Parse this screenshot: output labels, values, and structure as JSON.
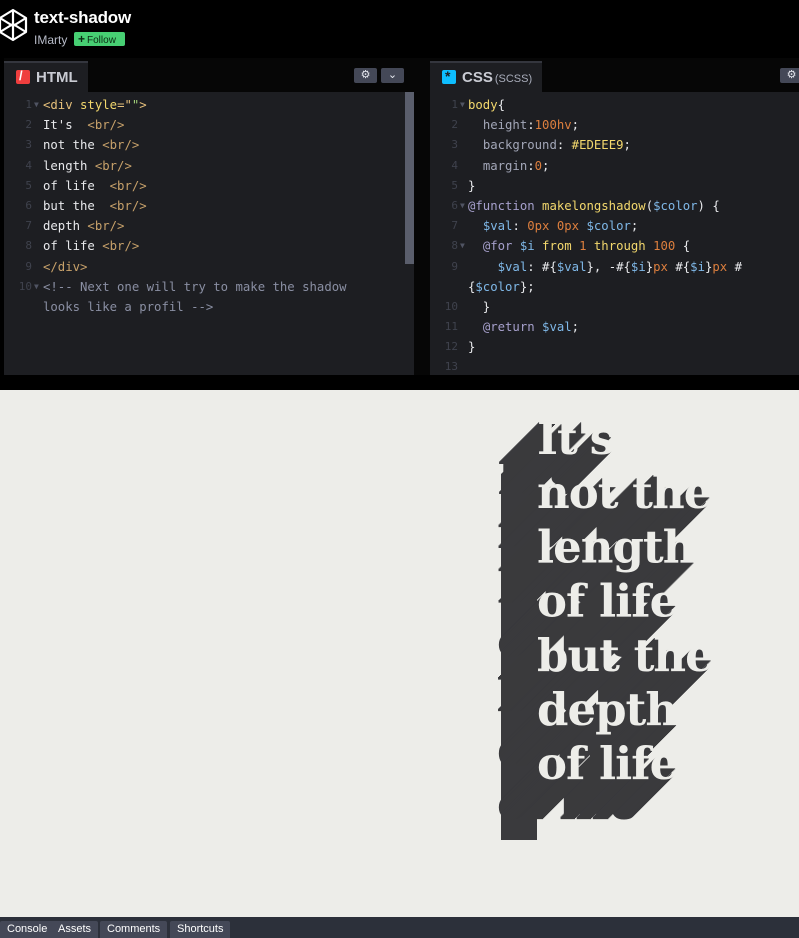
{
  "pen": {
    "title": "text-shadow",
    "author": "IMarty",
    "follow_label": "Follow",
    "follow_icon": "plus-icon"
  },
  "html_editor": {
    "tab_label": "HTML",
    "lines": [
      {
        "n": "1",
        "fold": true,
        "segs": [
          [
            "tag",
            "<div "
          ],
          [
            "sel",
            "style"
          ],
          [
            "tag",
            "=\""
          ],
          [
            "str",
            "\""
          ],
          [
            "tag",
            ">"
          ]
        ]
      },
      {
        "n": "2",
        "segs": [
          [
            "punc",
            "It's  "
          ],
          [
            "tag-d",
            "<br/>"
          ]
        ]
      },
      {
        "n": "3",
        "segs": [
          [
            "punc",
            "not the "
          ],
          [
            "tag-d",
            "<br/>"
          ]
        ]
      },
      {
        "n": "4",
        "segs": [
          [
            "punc",
            "length "
          ],
          [
            "tag-d",
            "<br/>"
          ]
        ]
      },
      {
        "n": "5",
        "segs": [
          [
            "punc",
            "of life  "
          ],
          [
            "tag-d",
            "<br/>"
          ]
        ]
      },
      {
        "n": "6",
        "segs": [
          [
            "punc",
            "but the  "
          ],
          [
            "tag-d",
            "<br/>"
          ]
        ]
      },
      {
        "n": "7",
        "segs": [
          [
            "punc",
            "depth "
          ],
          [
            "tag-d",
            "<br/>"
          ]
        ]
      },
      {
        "n": "8",
        "segs": [
          [
            "punc",
            "of life "
          ],
          [
            "tag-d",
            "<br/>"
          ]
        ]
      },
      {
        "n": "9",
        "segs": [
          [
            "tag-d",
            "</div>"
          ]
        ]
      },
      {
        "n": "10",
        "fold": true,
        "segs": [
          [
            "cmt",
            "<!-- Next one will try to make the shadow"
          ]
        ]
      },
      {
        "n": "",
        "segs": [
          [
            "cmt",
            "looks like a profil -->"
          ]
        ]
      }
    ]
  },
  "css_editor": {
    "tab_label": "CSS",
    "tab_sub": "(SCSS)",
    "lines": [
      {
        "n": "1",
        "fold": true,
        "segs": [
          [
            "sel",
            "body"
          ],
          [
            "punc",
            "{"
          ]
        ]
      },
      {
        "n": "2",
        "segs": [
          [
            "punc",
            "  "
          ],
          [
            "prop",
            "height"
          ],
          [
            "punc",
            ":"
          ],
          [
            "num",
            "100hv"
          ],
          [
            "punc",
            ";"
          ]
        ]
      },
      {
        "n": "3",
        "segs": [
          [
            "punc",
            "  "
          ],
          [
            "prop",
            "background"
          ],
          [
            "punc",
            ": "
          ],
          [
            "hex",
            "#EDEEE9"
          ],
          [
            "punc",
            ";"
          ]
        ]
      },
      {
        "n": "4",
        "segs": [
          [
            "punc",
            "  "
          ],
          [
            "prop",
            "margin"
          ],
          [
            "punc",
            ":"
          ],
          [
            "num",
            "0"
          ],
          [
            "punc",
            ";"
          ]
        ]
      },
      {
        "n": "5",
        "segs": [
          [
            "punc",
            "}"
          ]
        ]
      },
      {
        "n": "6",
        "fold": true,
        "segs": [
          [
            "kw",
            "@function "
          ],
          [
            "fn",
            "makelongshadow"
          ],
          [
            "punc",
            "("
          ],
          [
            "var",
            "$color"
          ],
          [
            "punc",
            ") {"
          ]
        ]
      },
      {
        "n": "7",
        "segs": [
          [
            "punc",
            "  "
          ],
          [
            "var",
            "$val"
          ],
          [
            "punc",
            ": "
          ],
          [
            "num",
            "0px 0px "
          ],
          [
            "var",
            "$color"
          ],
          [
            "punc",
            ";"
          ]
        ]
      },
      {
        "n": "8",
        "fold": true,
        "segs": [
          [
            "punc",
            "  "
          ],
          [
            "kw",
            "@for "
          ],
          [
            "var",
            "$i"
          ],
          [
            "fn",
            " from "
          ],
          [
            "num",
            "1"
          ],
          [
            "fn",
            " through "
          ],
          [
            "num",
            "100"
          ],
          [
            "punc",
            " {"
          ]
        ]
      },
      {
        "n": "9",
        "segs": [
          [
            "punc",
            "    "
          ],
          [
            "var",
            "$val"
          ],
          [
            "punc",
            ": #{"
          ],
          [
            "var",
            "$val"
          ],
          [
            "punc",
            "}, -#{"
          ],
          [
            "var",
            "$i"
          ],
          [
            "punc",
            "}"
          ],
          [
            "num",
            "px"
          ],
          [
            "punc",
            " #{"
          ],
          [
            "var",
            "$i"
          ],
          [
            "punc",
            "}"
          ],
          [
            "num",
            "px"
          ],
          [
            "punc",
            " #"
          ]
        ]
      },
      {
        "n": "",
        "segs": [
          [
            "punc",
            "{"
          ],
          [
            "var",
            "$color"
          ],
          [
            "punc",
            "};"
          ]
        ]
      },
      {
        "n": "10",
        "segs": [
          [
            "punc",
            "  }"
          ]
        ]
      },
      {
        "n": "11",
        "segs": [
          [
            "punc",
            "  "
          ],
          [
            "kw",
            "@return "
          ],
          [
            "var",
            "$val"
          ],
          [
            "punc",
            ";"
          ]
        ]
      },
      {
        "n": "12",
        "segs": [
          [
            "punc",
            "}"
          ]
        ]
      },
      {
        "n": "13",
        "segs": []
      }
    ]
  },
  "result": {
    "lines": [
      "It's",
      "not the",
      "length",
      "of life",
      "but the",
      "depth",
      "of life"
    ],
    "text_color": "#edede9",
    "shadow_color": "#3a3a3d",
    "background": "#edede9"
  },
  "bottom_bar": {
    "buttons": [
      "Console",
      "Assets",
      "Comments",
      "Shortcuts"
    ]
  }
}
